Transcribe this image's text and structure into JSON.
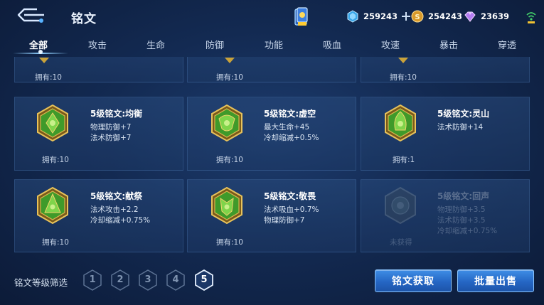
{
  "header": {
    "title": "铭文",
    "currency": {
      "gems": "259243",
      "gold": "254243",
      "crystals": "23639"
    }
  },
  "tabs": [
    {
      "label": "全部",
      "active": true
    },
    {
      "label": "攻击",
      "active": false
    },
    {
      "label": "生命",
      "active": false
    },
    {
      "label": "防御",
      "active": false
    },
    {
      "label": "功能",
      "active": false
    },
    {
      "label": "吸血",
      "active": false
    },
    {
      "label": "攻速",
      "active": false
    },
    {
      "label": "暴击",
      "active": false
    },
    {
      "label": "穿透",
      "active": false
    }
  ],
  "partial_row": [
    {
      "owned": "拥有:10"
    },
    {
      "owned": "拥有:10"
    },
    {
      "owned": "拥有:10"
    }
  ],
  "runes": [
    {
      "name": "5级铭文:均衡",
      "attrs": [
        "物理防御+7",
        "法术防御+7"
      ],
      "owned": "拥有:10",
      "locked": false
    },
    {
      "name": "5级铭文:虚空",
      "attrs": [
        "最大生命+45",
        "冷却缩减+0.5%"
      ],
      "owned": "拥有:10",
      "locked": false
    },
    {
      "name": "5级铭文:灵山",
      "attrs": [
        "法术防御+14"
      ],
      "owned": "拥有:1",
      "locked": false
    },
    {
      "name": "5级铭文:献祭",
      "attrs": [
        "法术攻击+2.2",
        "冷却缩减+0.75%"
      ],
      "owned": "拥有:10",
      "locked": false
    },
    {
      "name": "5级铭文:敬畏",
      "attrs": [
        "法术吸血+0.7%",
        "物理防御+7"
      ],
      "owned": "拥有:10",
      "locked": false
    },
    {
      "name": "5级铭文:回声",
      "attrs": [
        "物理防御+3.5",
        "法术防御+3.5",
        "冷却缩减+0.75%"
      ],
      "owned": "未获得",
      "locked": true
    }
  ],
  "filter": {
    "label": "铭文等级筛选",
    "levels": [
      "1",
      "2",
      "3",
      "4",
      "5"
    ],
    "selected": "5"
  },
  "buttons": {
    "get": "铭文获取",
    "sell": "批量出售"
  },
  "colors": {
    "accent_blue": "#2f7ad8",
    "rune_green": "#4fae2e",
    "rune_gold": "#c9a23a"
  }
}
